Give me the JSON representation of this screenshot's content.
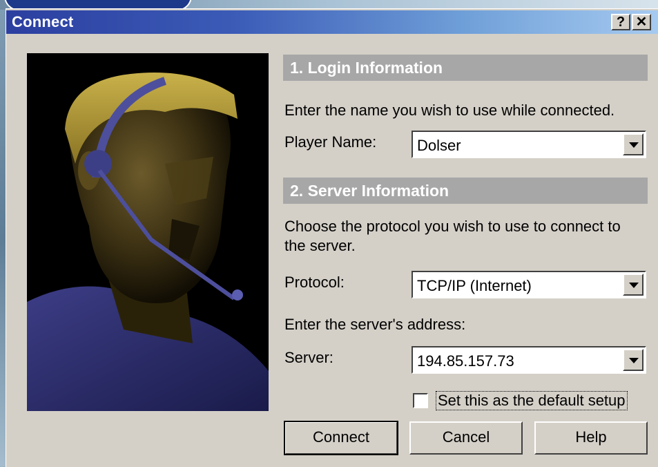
{
  "window": {
    "title": "Connect",
    "help_glyph": "?",
    "close_glyph": "✕"
  },
  "login": {
    "header": "1. Login Information",
    "instruction": "Enter the name you wish to use while connected.",
    "player_label": "Player Name:",
    "player_value": "Dolser"
  },
  "server": {
    "header": "2. Server Information",
    "instruction_line1": "Choose the protocol you wish to use to connect to",
    "instruction_line2": "the server.",
    "protocol_label": "Protocol:",
    "protocol_value": "TCP/IP (Internet)",
    "address_instruction": "Enter the server's address:",
    "server_label": "Server:",
    "server_value": "194.85.157.73"
  },
  "default_setup": {
    "label": "Set this as the default setup",
    "checked": false
  },
  "buttons": {
    "connect": "Connect",
    "cancel": "Cancel",
    "help": "Help"
  },
  "colors": {
    "titlebar_start": "#2c3fa0",
    "titlebar_end": "#a6caf0",
    "section_header_bg": "#a7a7a7",
    "dialog_bg": "#d4d0c8"
  }
}
